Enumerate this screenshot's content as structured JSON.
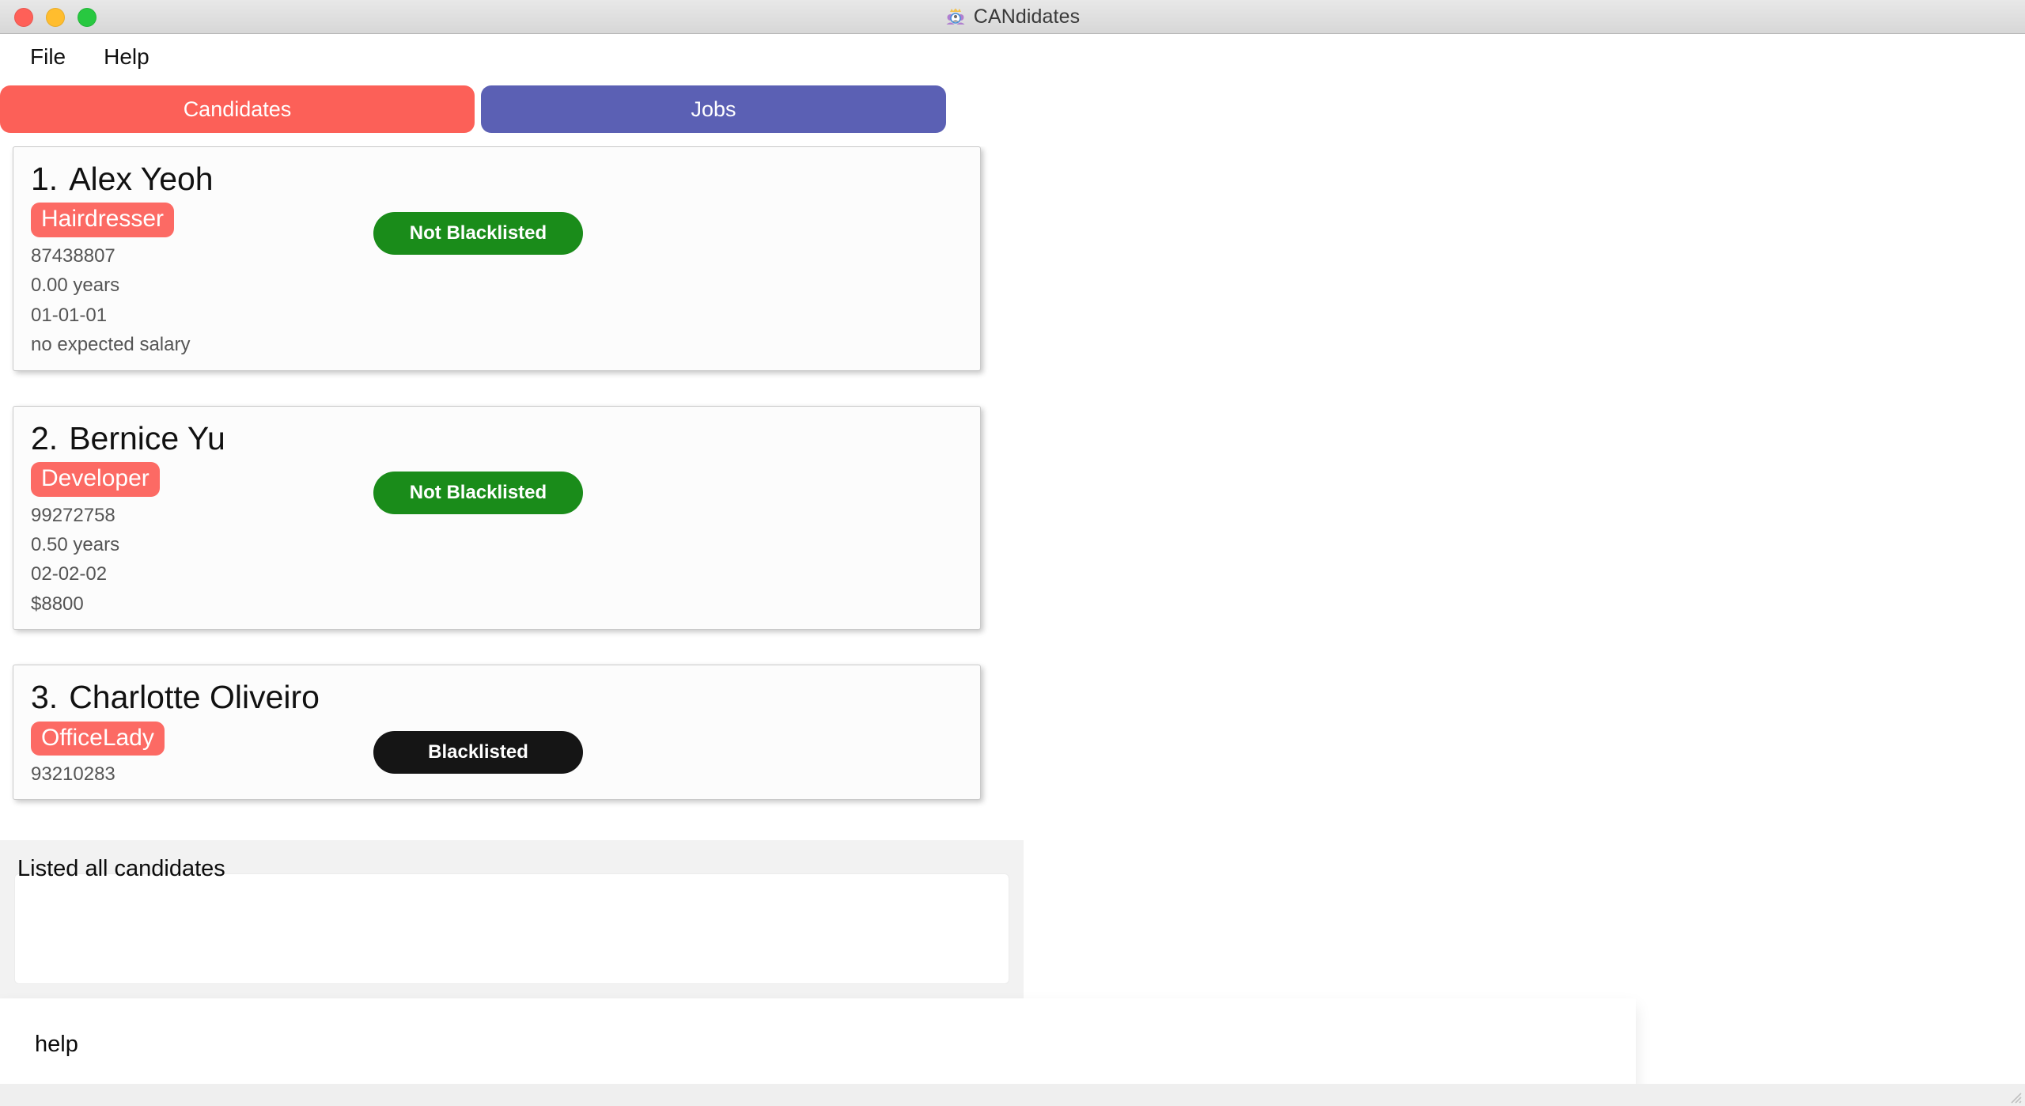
{
  "window": {
    "title": "CANdidates",
    "icon": "candidates-app-icon",
    "controls": {
      "close": "close-window-button",
      "minimize": "minimize-window-button",
      "maximize": "maximize-window-button"
    }
  },
  "menubar": {
    "items": [
      {
        "label": "File",
        "name": "menu-file"
      },
      {
        "label": "Help",
        "name": "menu-help"
      }
    ]
  },
  "tabs": [
    {
      "label": "Candidates",
      "name": "tab-candidates",
      "active": true,
      "color": "#fc6058"
    },
    {
      "label": "Jobs",
      "name": "tab-jobs",
      "active": false,
      "color": "#5b60b4"
    }
  ],
  "colors": {
    "accent_red": "#fc6058",
    "accent_purple": "#5b60b4",
    "tag_red": "#fc6a64",
    "status_clean_green": "#1a8c1a",
    "status_blacklisted_black": "#151515",
    "card_background": "#fcfcfc",
    "panel_background": "#f2f2f2"
  },
  "candidates": [
    {
      "index": "1.",
      "name": "Alex Yeoh",
      "tag": "Hairdresser",
      "phone": "87438807",
      "experience": "0.00 years",
      "date": "01-01-01",
      "salary": "no expected salary",
      "status": "Not Blacklisted",
      "blacklisted": false
    },
    {
      "index": "2.",
      "name": "Bernice Yu",
      "tag": "Developer",
      "phone": "99272758",
      "experience": "0.50 years",
      "date": "02-02-02",
      "salary": "$8800",
      "status": "Not Blacklisted",
      "blacklisted": false
    },
    {
      "index": "3.",
      "name": "Charlotte Oliveiro",
      "tag": "OfficeLady",
      "phone": "93210283",
      "experience": "",
      "date": "",
      "salary": "",
      "status": "Blacklisted",
      "blacklisted": true
    }
  ],
  "result_panel": {
    "message": "Listed all candidates"
  },
  "command": {
    "value": "help",
    "placeholder": "Enter command here..."
  }
}
